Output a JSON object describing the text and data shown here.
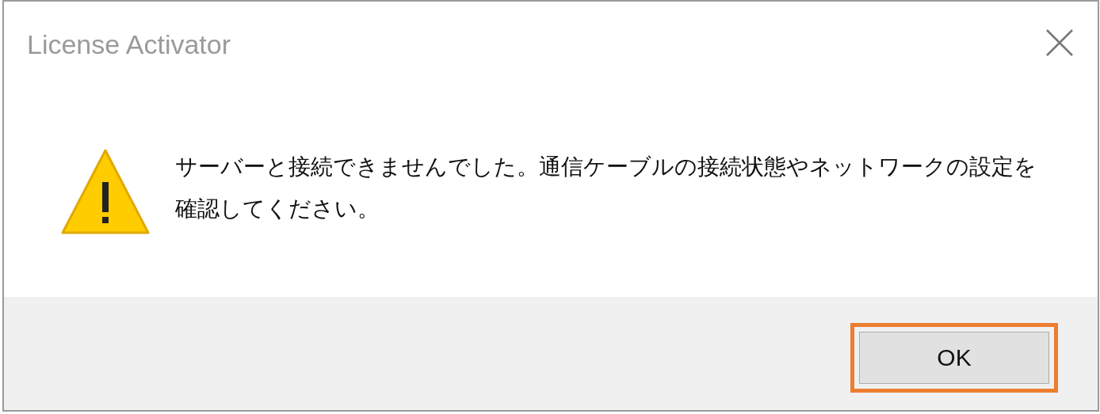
{
  "window": {
    "title": "License Activator"
  },
  "message": {
    "kind": "warning",
    "text": "サーバーと接続できませんでした。通信ケーブルの接続状態やネットワークの設定を確認してください。"
  },
  "buttons": [
    {
      "label": "OK",
      "highlighted": true
    }
  ]
}
